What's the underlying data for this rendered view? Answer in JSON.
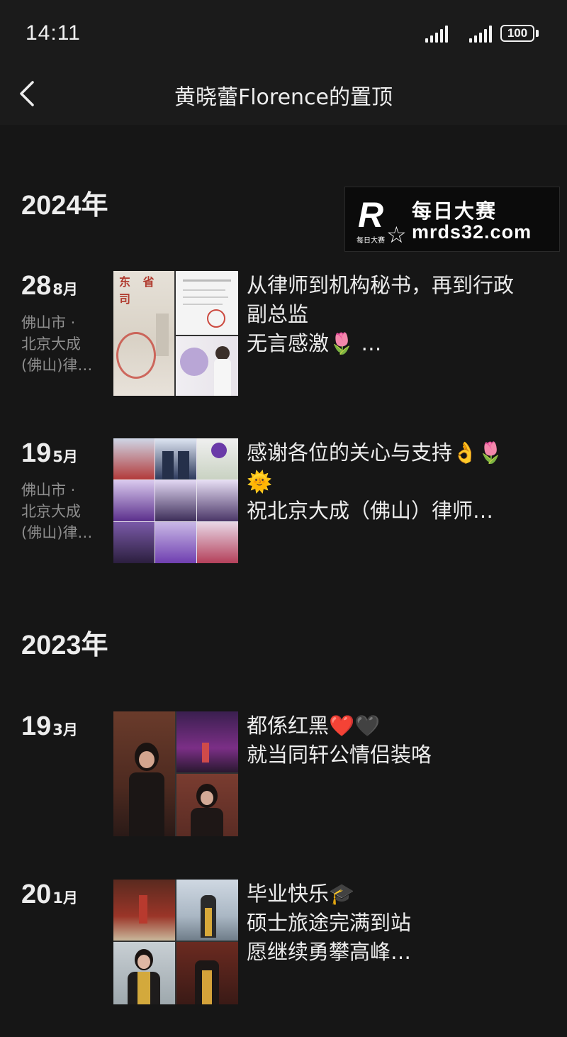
{
  "status_bar": {
    "time": "14:11",
    "battery": "100"
  },
  "nav": {
    "title": "黄晓蕾Florence的置顶"
  },
  "watermark": {
    "logo_letter": "R",
    "logo_small": "每日大赛",
    "line1": "每日大赛",
    "line2": "mrds32.com"
  },
  "years": [
    {
      "label": "2024年"
    },
    {
      "label": "2023年"
    }
  ],
  "posts": [
    {
      "day": "28",
      "month": "8月",
      "location_lines": [
        "佛山市 ·",
        "北京大成",
        "(佛山)律…"
      ],
      "text_lines": [
        "从律师到机构秘书，再到行政",
        "副总监",
        "无言感激🌷 …"
      ],
      "icons": [
        "tulip-emoji"
      ]
    },
    {
      "day": "19",
      "month": "5月",
      "location_lines": [
        "佛山市 ·",
        "北京大成",
        "(佛山)律…"
      ],
      "text_lines": [
        "感谢各位的关心与支持👌🌷",
        "🌞",
        "祝北京大成（佛山）律师…"
      ],
      "icons": [
        "ok-hand-emoji",
        "tulip-emoji",
        "sun-emoji"
      ]
    },
    {
      "day": "19",
      "month": "3月",
      "location_lines": [],
      "text_lines": [
        "都係红黑❤️🖤",
        "就当同轩公情侣装咯"
      ],
      "icons": [
        "red-heart-emoji",
        "black-heart-emoji"
      ]
    },
    {
      "day": "20",
      "month": "1月",
      "location_lines": [],
      "text_lines": [
        "毕业快乐🎓",
        "硕士旅途完满到站",
        "愿继续勇攀高峰…"
      ],
      "icons": [
        "graduation-cap-emoji"
      ]
    }
  ],
  "colors": {
    "background": "#161616",
    "bar": "#1b1b1b",
    "text": "#ececec",
    "muted": "#8d8d8d"
  }
}
